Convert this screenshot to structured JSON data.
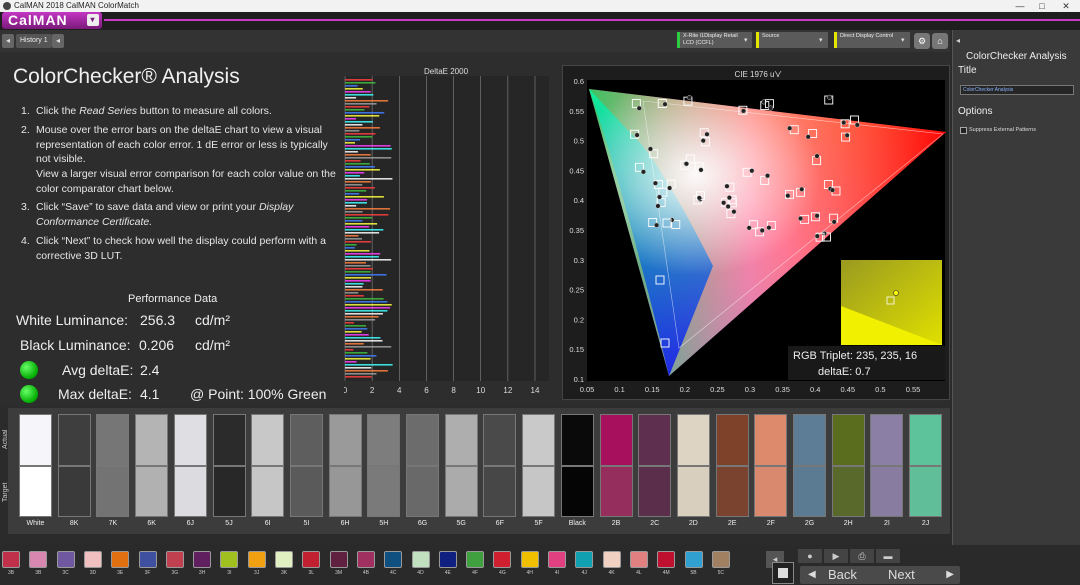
{
  "window": {
    "title": "CalMAN 2018 CalMAN ColorMatch",
    "minimize": "—",
    "maximize": "□",
    "close": "✕"
  },
  "menu": {
    "brand": "CalMAN",
    "dropdown": "▾"
  },
  "tabs": {
    "back": "◂",
    "history": "History 1",
    "add": "◂",
    "meter": "X-Rite i1Display Retail\nLCD (CCFL)",
    "source": "Source",
    "display": "Direct Display Control"
  },
  "right_panel": {
    "header": "ColorChecker Analysis",
    "title_label": "Title",
    "title_value": "ColorChecker Analysis",
    "options_label": "Options",
    "suppress_label": "Suppress External Patterns"
  },
  "main": {
    "title": "ColorChecker® Analysis",
    "steps": [
      {
        "n": "1.",
        "text": "Click the Read Series button to measure all colors."
      },
      {
        "n": "2.",
        "text": "Mouse over the error bars on the deltaE chart to view a visual representation of each color error. 1 dE error or less is typically not visible."
      },
      {
        "n": "",
        "text": "View a larger visual error comparison for each color value on the color comparator chart below."
      },
      {
        "n": "3.",
        "text": "Click “Save” to save data and view or print your Display Conformance Certificate."
      },
      {
        "n": "4.",
        "text": "Click “Next” to check how well the display could perform with a corrective 3D LUT."
      }
    ],
    "perf_title": "Performance Data",
    "white_lum_label": "White Luminance:",
    "white_lum_value": "256.3",
    "white_lum_unit": "cd/m²",
    "black_lum_label": "Black Luminance:",
    "black_lum_value": "0.206",
    "black_lum_unit": "cd/m²",
    "avg_label": "Avg deltaE:",
    "avg_value": "2.4",
    "max_label": "Max deltaE:",
    "max_value": "4.1",
    "max_point": "@ Point: 100% Green"
  },
  "deltae_chart": {
    "title": "DeltaE 2000",
    "ticks": [
      "0",
      "2",
      "4",
      "6",
      "8",
      "10",
      "12",
      "14"
    ]
  },
  "cie_chart": {
    "title": "CIE 1976 u'v'",
    "xticks": [
      "0.05",
      "0.1",
      "0.15",
      "0.2",
      "0.25",
      "0.3",
      "0.35",
      "0.4",
      "0.45",
      "0.5",
      "0.55"
    ],
    "yticks": [
      "0.6",
      "0.55",
      "0.5",
      "0.45",
      "0.4",
      "0.35",
      "0.3",
      "0.25",
      "0.2",
      "0.15",
      "0.1"
    ],
    "rgb_triplet": "RGB Triplet: 235, 235, 16",
    "deltae": "deltaE: 0.7"
  },
  "comparator": {
    "actual_label": "Actual",
    "target_label": "Target",
    "swatches": [
      {
        "label": "White",
        "actual": "#f5f5fa",
        "target": "#ffffff"
      },
      {
        "label": "8K",
        "actual": "#3e3e3e",
        "target": "#3a3a3a"
      },
      {
        "label": "7K",
        "actual": "#767676",
        "target": "#737373"
      },
      {
        "label": "6K",
        "actual": "#b4b4b4",
        "target": "#b1b1b1"
      },
      {
        "label": "6J",
        "actual": "#dfdfe3",
        "target": "#dcdce0"
      },
      {
        "label": "5J",
        "actual": "#2b2b2b",
        "target": "#282828"
      },
      {
        "label": "6I",
        "actual": "#c8c8c8",
        "target": "#c6c6c6"
      },
      {
        "label": "5I",
        "actual": "#5e5e5e",
        "target": "#5a5a5a"
      },
      {
        "label": "6H",
        "actual": "#9a9a9a",
        "target": "#979797"
      },
      {
        "label": "5H",
        "actual": "#7d7d7d",
        "target": "#7a7a7a"
      },
      {
        "label": "6G",
        "actual": "#6c6c6c",
        "target": "#696969"
      },
      {
        "label": "5G",
        "actual": "#aeaeae",
        "target": "#ababab"
      },
      {
        "label": "6F",
        "actual": "#4a4a4a",
        "target": "#474747"
      },
      {
        "label": "5F",
        "actual": "#c9c9c9",
        "target": "#c6c6c6"
      },
      {
        "label": "Black",
        "actual": "#0a0a0a",
        "target": "#050505"
      },
      {
        "label": "2B",
        "actual": "#a6105c",
        "target": "#952d5d"
      },
      {
        "label": "2C",
        "actual": "#5e2f4e",
        "target": "#5b2f4c"
      },
      {
        "label": "2D",
        "actual": "#ddd4c3",
        "target": "#d8cfbf"
      },
      {
        "label": "2E",
        "actual": "#7e4129",
        "target": "#7a4330"
      },
      {
        "label": "2F",
        "actual": "#dd8a6c",
        "target": "#d98a6e"
      },
      {
        "label": "2G",
        "actual": "#5d7d96",
        "target": "#5b7b92"
      },
      {
        "label": "2H",
        "actual": "#5a6d1f",
        "target": "#59682b"
      },
      {
        "label": "2I",
        "actual": "#8c7fa5",
        "target": "#897ca1"
      },
      {
        "label": "2J",
        "actual": "#5dc39a",
        "target": "#60bf99"
      }
    ]
  },
  "bottom_strip": [
    {
      "label": "3B",
      "color": "#c0304a"
    },
    {
      "label": "3B",
      "color": "#d888b0"
    },
    {
      "label": "3C",
      "color": "#7058a0"
    },
    {
      "label": "3D",
      "color": "#f0c0c0"
    },
    {
      "label": "3E",
      "color": "#e07010"
    },
    {
      "label": "3F",
      "color": "#4050a0"
    },
    {
      "label": "3G",
      "color": "#c04050"
    },
    {
      "label": "3H",
      "color": "#602060"
    },
    {
      "label": "3I",
      "color": "#a0c020"
    },
    {
      "label": "3J",
      "color": "#f0a010"
    },
    {
      "label": "3K",
      "color": "#e0f0c0"
    },
    {
      "label": "3L",
      "color": "#c02030"
    },
    {
      "label": "3M",
      "color": "#602040"
    },
    {
      "label": "4B",
      "color": "#a03060"
    },
    {
      "label": "4C",
      "color": "#105080"
    },
    {
      "label": "4D",
      "color": "#c0e0c0"
    },
    {
      "label": "4E",
      "color": "#102080"
    },
    {
      "label": "4F",
      "color": "#40a040"
    },
    {
      "label": "4G",
      "color": "#d02030"
    },
    {
      "label": "4H",
      "color": "#f0c000"
    },
    {
      "label": "4I",
      "color": "#e04080"
    },
    {
      "label": "4J",
      "color": "#10a0b0"
    },
    {
      "label": "4K",
      "color": "#f0d0c0"
    },
    {
      "label": "4L",
      "color": "#e08080"
    },
    {
      "label": "4M",
      "color": "#c01030"
    },
    {
      "label": "5B",
      "color": "#30a0d0"
    },
    {
      "label": "5C",
      "color": "#a08060"
    }
  ],
  "bottom_buttons": {
    "back": "Back",
    "next": "Next"
  }
}
